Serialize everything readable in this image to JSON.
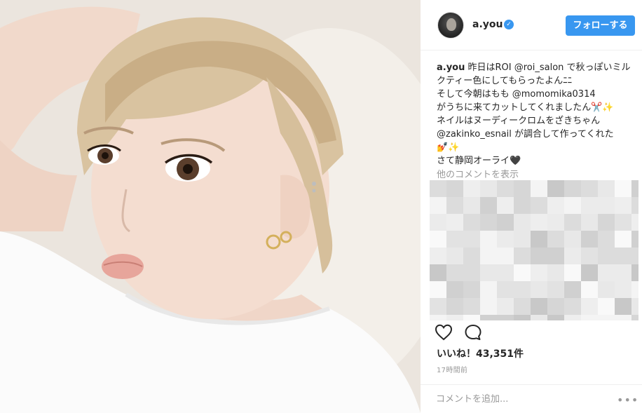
{
  "post": {
    "username": "a.you",
    "follow_label": "フォローする",
    "caption": {
      "user": "a.you",
      "text_1": " 昨日はROI ",
      "mention_1": "@roi_salon",
      "text_2": " で秋っぽいミルクティー色にしてもらったよんﾆﾆ",
      "line_2": "そして今朝はもも ",
      "mention_2": "@momomika0314",
      "line_3": "がうちに来てカットしてくれましたん✂️✨",
      "line_4": "ネイルはヌーディークロムをざきちゃん",
      "mention_3": "@zakinko_esnail",
      "text_3": " が調合して作ってくれた",
      "line_5": "💅✨",
      "line_6": "さて静岡オーライ🖤"
    },
    "more_comments": "他のコメントを表示",
    "likes_text": "いいね！43,351件",
    "timestamp": "17時間前",
    "comment_placeholder": "コメントを追加...",
    "more_options": "•••"
  },
  "icons": {
    "verified": "verified-badge-icon",
    "like": "heart-icon",
    "comment": "speech-bubble-icon"
  },
  "colors": {
    "accent": "#3897f0",
    "text": "#262626",
    "muted": "#999999"
  }
}
